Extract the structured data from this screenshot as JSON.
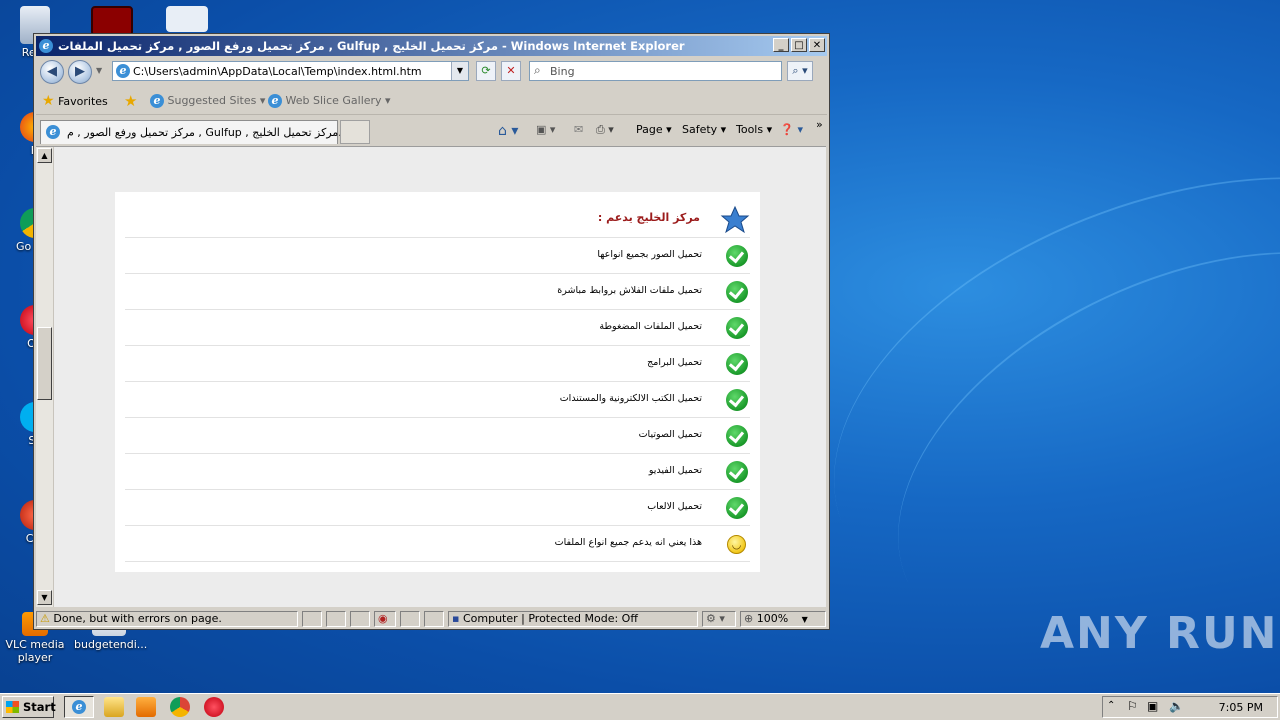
{
  "desktop": {
    "icons": [
      {
        "label": "Recy"
      },
      {
        "label": "Fi"
      },
      {
        "label": "Go Chr"
      },
      {
        "label": "Op"
      },
      {
        "label": "Sk"
      },
      {
        "label": "CCl"
      },
      {
        "label": "VLC media player"
      },
      {
        "label": "budgetendi..."
      }
    ]
  },
  "window": {
    "title": "مركز تحميل ورفع الصور , مركز تحميل الملفات , Gulfup , مركز تحميل الخليج - Windows Internet Explorer",
    "buttons": {
      "minimize": "_",
      "maximize": "□",
      "close": "✕"
    }
  },
  "address_bar": {
    "url": "C:\\Users\\admin\\AppData\\Local\\Temp\\index.html.htm",
    "search_placeholder": "Bing"
  },
  "favorites_bar": {
    "favorites_label": "Favorites",
    "items": [
      {
        "label": "Suggested Sites ▾"
      },
      {
        "label": "Web Slice Gallery ▾"
      }
    ]
  },
  "tabs": [
    {
      "label": "مركز تحميل ورفع الصور , م , Gulfup , مركز تحميل الخليج..."
    }
  ],
  "command_bar": {
    "page_label": "Page ▾",
    "safety_label": "Safety ▾",
    "tools_label": "Tools ▾",
    "more_label": "»"
  },
  "content": {
    "panel_title": "مركز الخليج يدعم :",
    "features": [
      {
        "text": "تحميل الصور بجميع انواعها",
        "status": "check"
      },
      {
        "text": "تحميل ملفات الفلاش بروابط مباشرة",
        "status": "check"
      },
      {
        "text": "تحميل الملفات المضغوطة",
        "status": "check"
      },
      {
        "text": "تحميل البرامج",
        "status": "check"
      },
      {
        "text": "تحميل الكتب الالكترونية والمستندات",
        "status": "check"
      },
      {
        "text": "تحميل الصوتيات",
        "status": "check"
      },
      {
        "text": "تحميل الفيديو",
        "status": "check"
      },
      {
        "text": "تحميل الالعاب",
        "status": "check"
      },
      {
        "text": "هذا يعني انه يدعم جميع انواع الملفات",
        "status": "smile"
      }
    ]
  },
  "status_bar": {
    "message": "Done, but with errors on page.",
    "zone": "Computer | Protected Mode: Off",
    "zoom": "100%"
  },
  "taskbar": {
    "start_label": "Start",
    "clock": "7:05 PM"
  },
  "watermark": "ANY RUN",
  "colors": {
    "title_gradient_start": "#0a246a",
    "title_gradient_end": "#a6caf0",
    "panel_title_color": "#9b1b1b",
    "check_green": "#1a9a2a"
  }
}
